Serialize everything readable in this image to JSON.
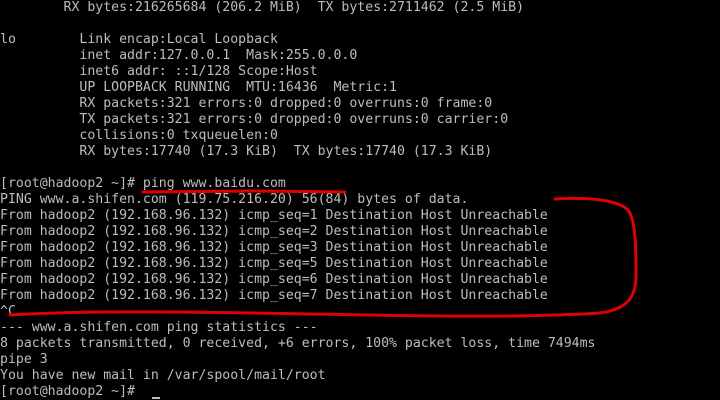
{
  "terminal": {
    "background_color": "#000000",
    "text_color": "#bdbdbd",
    "annotation_color": "#e00000",
    "lines": [
      "        RX bytes:216265684 (206.2 MiB)  TX bytes:2711462 (2.5 MiB)",
      "",
      "lo        Link encap:Local Loopback",
      "          inet addr:127.0.0.1  Mask:255.0.0.0",
      "          inet6 addr: ::1/128 Scope:Host",
      "          UP LOOPBACK RUNNING  MTU:16436  Metric:1",
      "          RX packets:321 errors:0 dropped:0 overruns:0 frame:0",
      "          TX packets:321 errors:0 dropped:0 overruns:0 carrier:0",
      "          collisions:0 txqueuelen:0",
      "          RX bytes:17740 (17.3 KiB)  TX bytes:17740 (17.3 KiB)",
      "",
      "[root@hadoop2 ~]# ping www.baidu.com",
      "PING www.a.shifen.com (119.75.216.20) 56(84) bytes of data.",
      "From hadoop2 (192.168.96.132) icmp_seq=1 Destination Host Unreachable",
      "From hadoop2 (192.168.96.132) icmp_seq=2 Destination Host Unreachable",
      "From hadoop2 (192.168.96.132) icmp_seq=3 Destination Host Unreachable",
      "From hadoop2 (192.168.96.132) icmp_seq=5 Destination Host Unreachable",
      "From hadoop2 (192.168.96.132) icmp_seq=6 Destination Host Unreachable",
      "From hadoop2 (192.168.96.132) icmp_seq=7 Destination Host Unreachable",
      "^C",
      "--- www.a.shifen.com ping statistics ---",
      "8 packets transmitted, 0 received, +6 errors, 100% packet loss, time 7494ms",
      "pipe 3",
      "You have new mail in /var/spool/mail/root",
      "[root@hadoop2 ~]# "
    ]
  }
}
